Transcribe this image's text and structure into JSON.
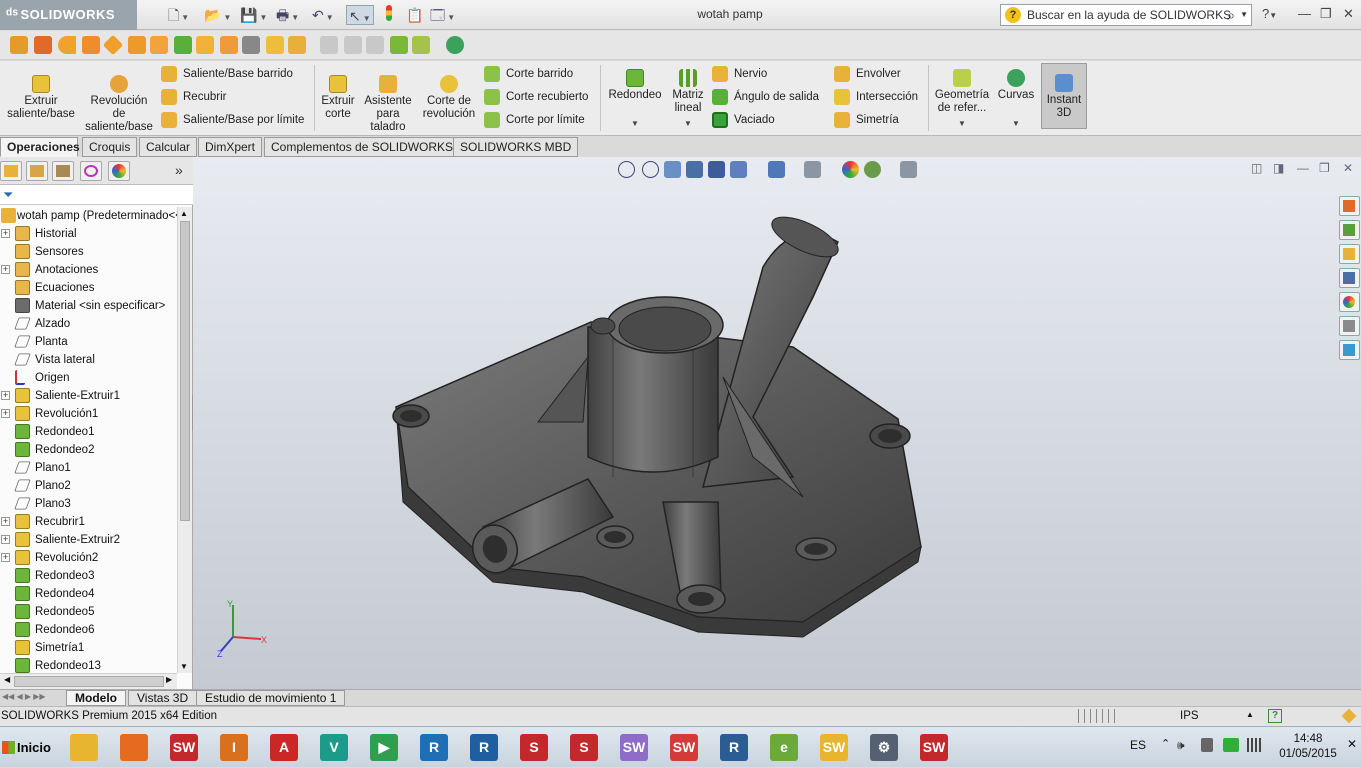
{
  "app": {
    "logo": "SOLIDWORKS",
    "window_title": "wotah pamp",
    "search_placeholder": "Buscar en la ayuda de SOLIDWORKS",
    "help_symbol": "?"
  },
  "ribbon": {
    "extrude_boss": "Extruir saliente/base",
    "revolve_boss": "Revolución de saliente/base",
    "swept_boss": "Saliente/Base barrido",
    "loft": "Recubrir",
    "boundary_boss": "Saliente/Base por límite",
    "extruded_cut": "Extruir corte",
    "hole_wizard": "Asistente para taladro",
    "revolved_cut": "Corte de revolución",
    "swept_cut": "Corte barrido",
    "lofted_cut": "Corte recubierto",
    "boundary_cut": "Corte por límite",
    "fillet": "Redondeo",
    "linear_pattern": "Matriz lineal",
    "rib": "Nervio",
    "draft": "Ángulo de salida",
    "shell": "Vaciado",
    "wrap": "Envolver",
    "intersect": "Intersección",
    "mirror": "Simetría",
    "ref_geometry": "Geometría de refer...",
    "curves": "Curvas",
    "instant3d": "Instant 3D"
  },
  "tabs": [
    "Operaciones",
    "Croquis",
    "Calcular",
    "DimXpert",
    "Complementos de SOLIDWORKS",
    "SOLIDWORKS MBD"
  ],
  "tree": {
    "root": "wotah pamp  (Predeterminado<<",
    "items": [
      {
        "label": "Historial",
        "exp": true,
        "color": "#e9b64a"
      },
      {
        "label": "Sensores",
        "exp": false,
        "color": "#e9b64a"
      },
      {
        "label": "Anotaciones",
        "exp": true,
        "color": "#e9b64a"
      },
      {
        "label": "Ecuaciones",
        "exp": false,
        "color": "#e9b64a"
      },
      {
        "label": "Material <sin especificar>",
        "exp": false,
        "color": "#6c6c6c"
      },
      {
        "label": "Alzado",
        "exp": false,
        "color": "plane"
      },
      {
        "label": "Planta",
        "exp": false,
        "color": "plane"
      },
      {
        "label": "Vista lateral",
        "exp": false,
        "color": "plane"
      },
      {
        "label": "Origen",
        "exp": false,
        "color": "origin"
      },
      {
        "label": "Saliente-Extruir1",
        "exp": true,
        "color": "#e8c23a"
      },
      {
        "label": "Revolución1",
        "exp": true,
        "color": "#e8c23a"
      },
      {
        "label": "Redondeo1",
        "exp": false,
        "color": "#6cb63a"
      },
      {
        "label": "Redondeo2",
        "exp": false,
        "color": "#6cb63a"
      },
      {
        "label": "Plano1",
        "exp": false,
        "color": "plane"
      },
      {
        "label": "Plano2",
        "exp": false,
        "color": "plane"
      },
      {
        "label": "Plano3",
        "exp": false,
        "color": "plane"
      },
      {
        "label": "Recubrir1",
        "exp": true,
        "color": "#e8c23a"
      },
      {
        "label": "Saliente-Extruir2",
        "exp": true,
        "color": "#e8c23a"
      },
      {
        "label": "Revolución2",
        "exp": true,
        "color": "#e8c23a"
      },
      {
        "label": "Redondeo3",
        "exp": false,
        "color": "#6cb63a"
      },
      {
        "label": "Redondeo4",
        "exp": false,
        "color": "#6cb63a"
      },
      {
        "label": "Redondeo5",
        "exp": false,
        "color": "#6cb63a"
      },
      {
        "label": "Redondeo6",
        "exp": false,
        "color": "#6cb63a"
      },
      {
        "label": "Simetría1",
        "exp": false,
        "color": "#e8c23a"
      },
      {
        "label": "Redondeo13",
        "exp": false,
        "color": "#6cb63a"
      }
    ]
  },
  "bottom_tabs": [
    "Modelo",
    "Vistas 3D",
    "Estudio de movimiento 1"
  ],
  "status": {
    "edition": "SOLIDWORKS Premium 2015 x64 Edition",
    "units": "IPS"
  },
  "taskbar": {
    "start": "Inicio",
    "lang": "ES",
    "time": "14:48",
    "date": "01/05/2015",
    "apps": [
      {
        "name": "explorer-icon",
        "color": "#e8b531",
        "text": ""
      },
      {
        "name": "firefox-icon",
        "color": "#e56b1f",
        "text": ""
      },
      {
        "name": "solidworks-2015-icon",
        "color": "#c3282c",
        "text": "SW"
      },
      {
        "name": "inventor-pro-icon",
        "color": "#d8701d",
        "text": "I"
      },
      {
        "name": "autocad-icon",
        "color": "#cc2727",
        "text": "A"
      },
      {
        "name": "vault-icon",
        "color": "#1c9a8a",
        "text": "V"
      },
      {
        "name": "autodesk-green-icon",
        "color": "#2f9e4f",
        "text": "▶"
      },
      {
        "name": "revit-icon",
        "color": "#1f6fb5",
        "text": "R"
      },
      {
        "name": "revit-2-icon",
        "color": "#1f5f9f",
        "text": "R"
      },
      {
        "name": "solidworks-electrical-icon",
        "color": "#c3282c",
        "text": "S"
      },
      {
        "name": "solidworks-composer-icon",
        "color": "#c3282c",
        "text": "S"
      },
      {
        "name": "solidworks-plastics-icon",
        "color": "#8e6cc7",
        "text": "SW"
      },
      {
        "name": "solidworks-explorer-icon",
        "color": "#d43a3a",
        "text": "SW"
      },
      {
        "name": "revit-viewer-icon",
        "color": "#2c5c94",
        "text": "R"
      },
      {
        "name": "edrawings-icon",
        "color": "#6aa93a",
        "text": "e"
      },
      {
        "name": "solidworks-toolbox-icon",
        "color": "#e8b531",
        "text": "SW"
      },
      {
        "name": "toolbox-settings-icon",
        "color": "#556070",
        "text": "⚙"
      },
      {
        "name": "solidworks-2015-b-icon",
        "color": "#c3282c",
        "text": "SW"
      }
    ]
  }
}
